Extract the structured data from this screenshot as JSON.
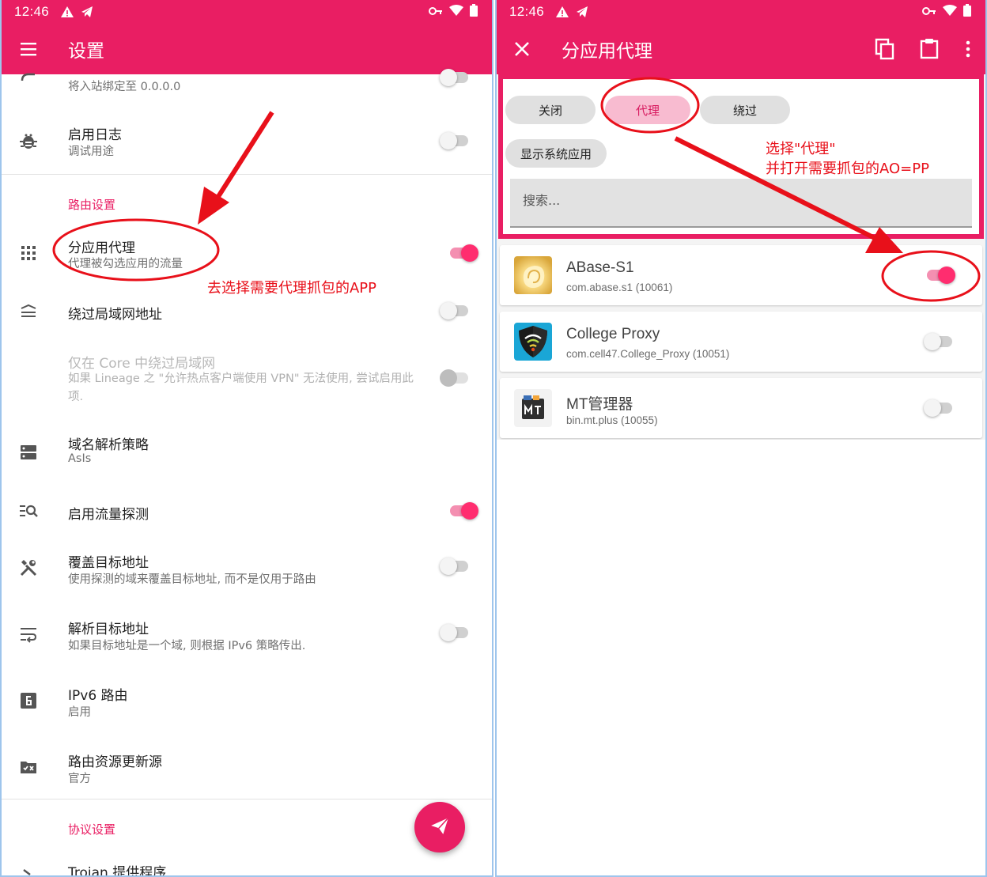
{
  "left": {
    "status": {
      "time": "12:46"
    },
    "appbar": {
      "title": "设置"
    },
    "rows": {
      "bind_inbound": {
        "sub": "将入站绑定至 0.0.0.0"
      },
      "logs": {
        "title": "启用日志",
        "sub": "调试用途"
      },
      "routing_section": "路由设置",
      "per_app_proxy": {
        "title": "分应用代理",
        "sub": "代理被勾选应用的流量"
      },
      "bypass_lan": {
        "title": "绕过局域网地址"
      },
      "bypass_lan_core": {
        "title": "仅在 Core 中绕过局域网",
        "sub": "如果 Lineage 之 \"允许热点客户端使用 VPN\" 无法使用, 尝试启用此项."
      },
      "domain_strategy": {
        "title": "域名解析策略",
        "sub": "AsIs"
      },
      "traffic_sniffing": {
        "title": "启用流量探测"
      },
      "override_dest": {
        "title": "覆盖目标地址",
        "sub": "使用探测的域来覆盖目标地址, 而不是仅用于路由"
      },
      "resolve_dest": {
        "title": "解析目标地址",
        "sub": "如果目标地址是一个域, 则根据 IPv6 策略传出."
      },
      "ipv6_route": {
        "title": "IPv6 路由",
        "sub": "启用"
      },
      "route_assets": {
        "title": "路由资源更新源",
        "sub": "官方"
      },
      "protocol_section": "协议设置",
      "trojan_provider": {
        "title": "Trojan 提供程序"
      }
    },
    "switches": {
      "logs": false,
      "per_app_proxy": true,
      "bypass_lan": false,
      "bypass_lan_core": false,
      "traffic_sniffing": true,
      "override_dest": false,
      "resolve_dest": false
    },
    "annotation": "去选择需要代理抓包的APP"
  },
  "right": {
    "status": {
      "time": "12:46"
    },
    "appbar": {
      "title": "分应用代理"
    },
    "chips": {
      "off": "关闭",
      "proxy": "代理",
      "bypass": "绕过",
      "show_system": "显示系统应用"
    },
    "selected_mode": "proxy",
    "search": {
      "placeholder": "搜索..."
    },
    "apps": [
      {
        "name": "ABase-S1",
        "pkg": "com.abase.s1 (10061)",
        "enabled": true,
        "icon": "abase-icon"
      },
      {
        "name": "College Proxy",
        "pkg": "com.cell47.College_Proxy (10051)",
        "enabled": false,
        "icon": "college-proxy-icon"
      },
      {
        "name": "MT管理器",
        "pkg": "bin.mt.plus (10055)",
        "enabled": false,
        "icon": "mt-manager-icon"
      }
    ],
    "annotation": {
      "line1": "选择\"代理\"",
      "line2": "并打开需要抓包的AO=PP"
    }
  },
  "colors": {
    "accent": "#e91e63",
    "annotation": "#e8101a",
    "switch_on": "#ff2d6f"
  }
}
